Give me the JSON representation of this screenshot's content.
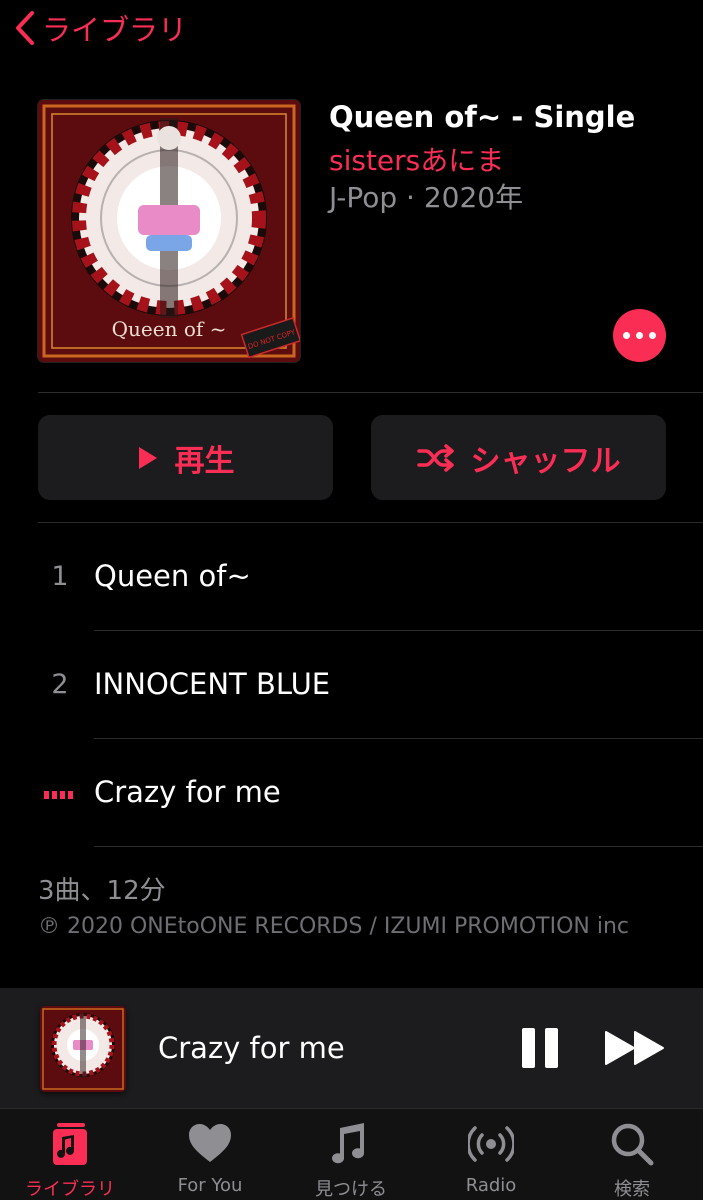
{
  "nav": {
    "back_label": "ライブラリ"
  },
  "album": {
    "title": "Queen of~ - Single",
    "artist": "sistersあにま",
    "meta": "J-Pop · 2020年",
    "art_lettering": "Queen of ~",
    "art_badge": "DO NOT COPY"
  },
  "actions": {
    "play_label": "再生",
    "shuffle_label": "シャッフル"
  },
  "tracks": [
    {
      "number": "1",
      "title": "Queen of~",
      "playing": false
    },
    {
      "number": "2",
      "title": "INNOCENT BLUE",
      "playing": false
    },
    {
      "number": "",
      "title": "Crazy for me",
      "playing": true
    }
  ],
  "summary": "3曲、12分",
  "copyright": "℗ 2020 ONEtoONE RECORDS / IZUMI PROMOTION inc",
  "now_playing": {
    "title": "Crazy for me"
  },
  "tabs": [
    {
      "label": "ライブラリ",
      "icon": "library-icon",
      "active": true
    },
    {
      "label": "For You",
      "icon": "heart-icon",
      "active": false
    },
    {
      "label": "見つける",
      "icon": "music-note-icon",
      "active": false
    },
    {
      "label": "Radio",
      "icon": "radio-icon",
      "active": false
    },
    {
      "label": "検索",
      "icon": "search-icon",
      "active": false
    }
  ],
  "colors": {
    "accent": "#fa2d55",
    "background": "#000000",
    "secondary_text": "#8e8e93",
    "card": "#1c1c1e"
  }
}
